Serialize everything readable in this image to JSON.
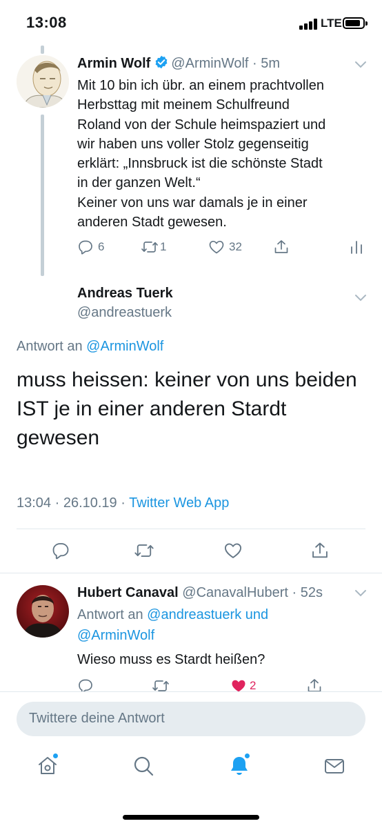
{
  "status": {
    "time": "13:08",
    "network": "LTE"
  },
  "quoted_tweet": {
    "name": "Armin Wolf",
    "handle": "@ArminWolf",
    "separator": " · ",
    "age": "5m",
    "text_lines": [
      "Mit 10 bin ich übr. an einem prachtvollen",
      "Herbsttag mit meinem Schulfreund",
      "Roland von der Schule heimspaziert und",
      "wir haben uns voller Stolz gegenseitig",
      "erklärt: „Innsbruck ist die schönste Stadt",
      "in der ganzen Welt.“",
      "Keiner von uns war damals je in einer",
      "anderen Stadt gewesen."
    ],
    "replies": "6",
    "retweets": "1",
    "likes": "32"
  },
  "main_tweet": {
    "name": "Andreas Tuerk",
    "handle": "@andreastuerk",
    "reply_prefix": "Antwort an ",
    "reply_handle": "@ArminWolf",
    "text_lines": [
      "muss heissen: keiner von uns beiden",
      "IST je in einer anderen Stardt",
      "gewesen"
    ],
    "time": "13:04 · 26.10.19 · ",
    "client": "Twitter Web App"
  },
  "reply_tweet": {
    "name": "Hubert Canaval",
    "handle": "@CanavalHubert",
    "separator": " · ",
    "age": "52s",
    "reply_prefix": "Antwort an ",
    "reply_handle_1": "@andreastuerk und",
    "reply_handle_2": "@ArminWolf",
    "text": "Wieso muss es Stardt heißen?",
    "likes": "2",
    "like_color": "#e0245e"
  },
  "reply_bar": {
    "placeholder": "Twittere deine Antwort"
  },
  "colors": {
    "accent": "#1da1f2",
    "link": "#1b95e0",
    "muted": "#657786"
  },
  "tabs": [
    "home-icon",
    "search-icon",
    "notifications-icon",
    "messages-icon"
  ]
}
